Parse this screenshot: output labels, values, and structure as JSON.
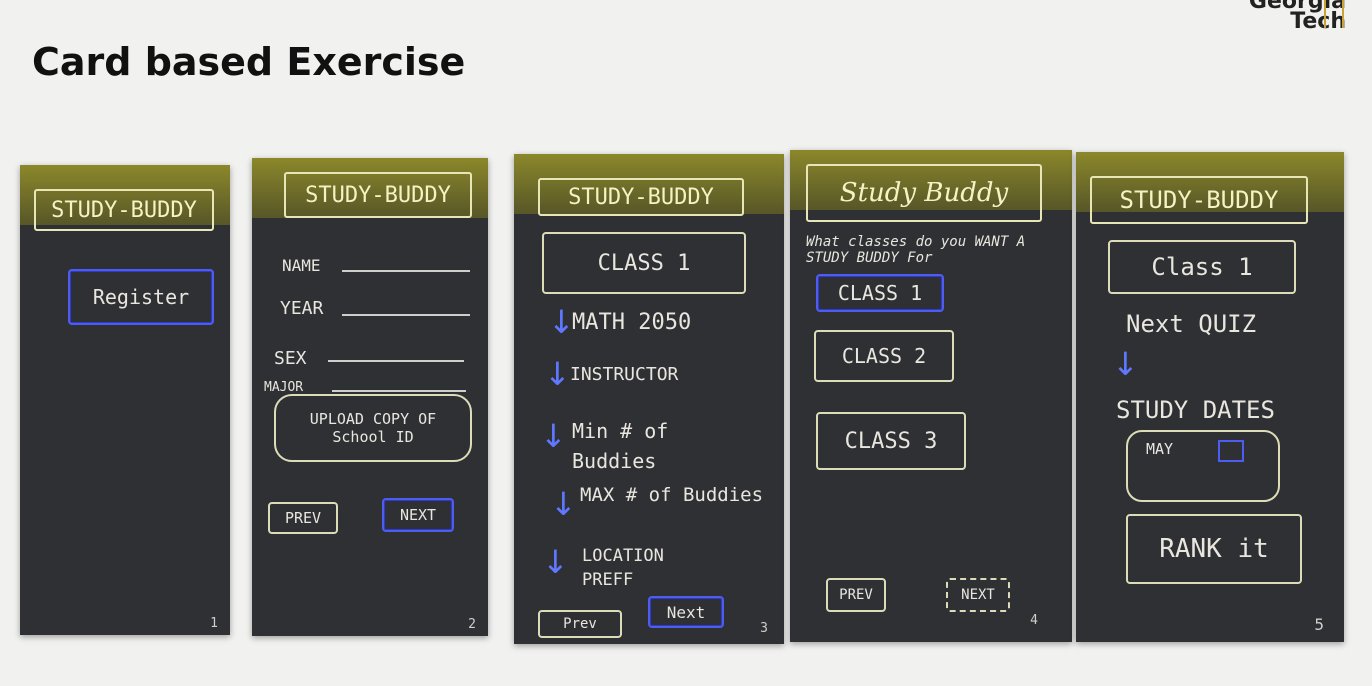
{
  "slide": {
    "title": "Card based Exercise",
    "logo_line1": "Georgia",
    "logo_line2": "Tech"
  },
  "cards": [
    {
      "title": "STUDY-BUDDY",
      "register": "Register",
      "page": "1"
    },
    {
      "title": "STUDY-BUDDY",
      "name": "NAME",
      "year": "YEAR",
      "sex": "SEX",
      "major": "MAJOR",
      "upload": "UPLOAD COPY OF School ID",
      "prev": "PREV",
      "next": "NEXT",
      "page": "2"
    },
    {
      "title": "STUDY-BUDDY",
      "class": "CLASS 1",
      "math": "MATH 2050",
      "instructor": "INSTRUCTOR",
      "min": "Min # of Buddies",
      "max": "MAX # of Buddies",
      "location": "LOCATION PREFF",
      "prev": "Prev",
      "next": "Next",
      "page": "3"
    },
    {
      "title": "Study Buddy",
      "question": "What classes do you WANT A STUDY BUDDY For",
      "class1": "CLASS 1",
      "class2": "CLASS 2",
      "class3": "CLASS 3",
      "prev": "PREV",
      "next": "NEXT",
      "page": "4"
    },
    {
      "title": "STUDY-BUDDY",
      "class": "Class 1",
      "next_quiz": "Next QUIZ",
      "study_dates": "STUDY DATES",
      "month": "MAY",
      "rank": "RANK it",
      "page": "5"
    }
  ]
}
